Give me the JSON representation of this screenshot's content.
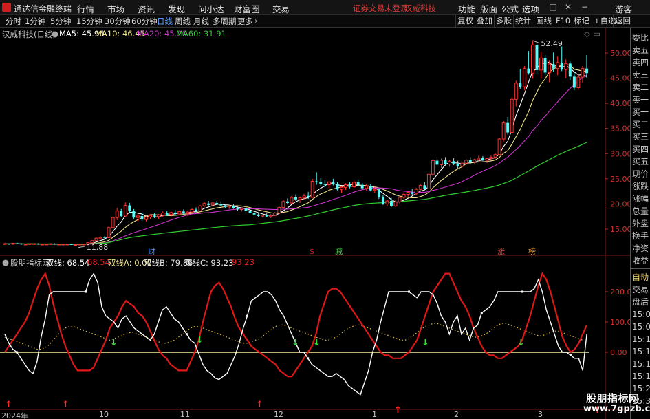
{
  "titlebar": {
    "app_name": "通达信金融终端",
    "menus": [
      "行情",
      "市场",
      "资讯",
      "发现",
      "问小达",
      "财富圈",
      "交易"
    ],
    "notice": "证券交易未登录",
    "stock_name": "汉威科技",
    "right_menus": [
      "功能",
      "版面",
      "公式",
      "选项"
    ],
    "guest": "游客"
  },
  "toolbar": {
    "periods": [
      "分时",
      "1分钟",
      "5分钟",
      "15分钟",
      "30分钟",
      "60分钟",
      "日线",
      "周线",
      "月线",
      "多周期",
      "更多"
    ],
    "active_period": "日线",
    "right_buttons": [
      "复权",
      "叠加",
      "多股",
      "统计",
      "画线",
      "F10",
      "标记",
      "+自选",
      "返回"
    ]
  },
  "main_info": {
    "title": "汉威科技(日线)",
    "ma5": "MA5: 45.96",
    "ma10": "MA10: 46.45",
    "ma20": "MA20: 45.20",
    "ma60": "MA60: 31.91",
    "colors": {
      "ma5": "#ffffff",
      "ma10": "#f0e68c",
      "ma20": "#cc33cc",
      "ma60": "#33cc33"
    }
  },
  "price_axis": [
    "50.00",
    "45.00",
    "40.00",
    "35.00",
    "30.00",
    "25.00",
    "20.00",
    "15.00"
  ],
  "annotations": {
    "high": "52.49",
    "low": "11.88",
    "badges": [
      "财",
      "$",
      "减",
      "涨",
      "榜"
    ]
  },
  "indicator_info": {
    "name": "股朋指标网",
    "line": "双线: 68.54",
    "line_value2": "68.54",
    "a": "双线A: 0.00",
    "b": "双线B: 79.86",
    "c": "双线C: 93.23",
    "c_value2": "93.23"
  },
  "indicator_axis": [
    "200.00",
    "100.00",
    "0.00"
  ],
  "date_axis": [
    "2024年",
    "10",
    "11",
    "12",
    "1",
    "2",
    "3"
  ],
  "right_panel": {
    "top_items": [
      "委比",
      "卖五",
      "卖四",
      "卖三",
      "卖二",
      "卖一",
      "买一",
      "买二",
      "买三",
      "买四",
      "买五",
      "现价",
      "涨跌",
      "涨幅",
      "总量",
      "外盘",
      "换手",
      "净资",
      "收益"
    ],
    "bottom_items": [
      "自动",
      "交易",
      "盘后",
      "15:00",
      "15:08",
      "15:10",
      "15:11",
      "15:15",
      "15:16",
      "15:25",
      "15:30"
    ]
  },
  "watermark": {
    "line1": "股朋指标网",
    "line2": "www.7gpzb.com"
  },
  "chart_data": {
    "type": "candlestick",
    "y_range": [
      10,
      55
    ],
    "ohlc": [
      [
        12.0,
        12.3,
        11.9,
        12.1
      ],
      [
        12.1,
        12.2,
        11.9,
        12.0
      ],
      [
        12.0,
        12.3,
        11.9,
        12.2
      ],
      [
        12.2,
        12.3,
        12.0,
        12.1
      ],
      [
        12.1,
        12.2,
        11.9,
        12.0
      ],
      [
        12.0,
        12.1,
        11.9,
        12.0
      ],
      [
        12.0,
        12.2,
        11.9,
        12.1
      ],
      [
        12.1,
        12.2,
        12.0,
        12.1
      ],
      [
        12.1,
        12.2,
        11.9,
        12.0
      ],
      [
        12.0,
        12.1,
        11.9,
        12.0
      ],
      [
        12.0,
        12.1,
        11.9,
        12.0
      ],
      [
        12.0,
        12.2,
        11.9,
        12.1
      ],
      [
        12.1,
        12.2,
        11.9,
        12.0
      ],
      [
        12.0,
        12.1,
        11.9,
        12.0
      ],
      [
        12.0,
        12.1,
        11.9,
        12.0
      ],
      [
        12.0,
        12.1,
        11.9,
        12.0
      ],
      [
        12.0,
        12.0,
        11.9,
        11.9
      ],
      [
        11.9,
        12.0,
        11.88,
        11.9
      ],
      [
        11.9,
        12.1,
        11.9,
        12.0
      ],
      [
        12.0,
        12.1,
        11.9,
        12.0
      ],
      [
        12.0,
        12.4,
        11.9,
        12.3
      ],
      [
        12.3,
        12.8,
        12.2,
        12.7
      ],
      [
        12.7,
        13.3,
        12.6,
        13.2
      ],
      [
        13.2,
        13.6,
        13.0,
        13.4
      ],
      [
        13.4,
        13.6,
        13.1,
        13.3
      ],
      [
        13.3,
        15.5,
        13.2,
        15.3
      ],
      [
        15.3,
        17.5,
        15.2,
        17.3
      ],
      [
        17.3,
        19.2,
        16.8,
        18.6
      ],
      [
        18.6,
        19.0,
        17.4,
        17.6
      ],
      [
        17.6,
        20.3,
        17.5,
        19.7
      ],
      [
        19.7,
        20.2,
        18.2,
        18.6
      ],
      [
        18.6,
        19.0,
        17.0,
        17.3
      ],
      [
        17.3,
        18.0,
        16.5,
        17.6
      ],
      [
        17.6,
        18.3,
        16.6,
        16.9
      ],
      [
        16.9,
        17.6,
        16.5,
        17.4
      ],
      [
        17.4,
        18.0,
        17.0,
        17.7
      ],
      [
        17.7,
        18.2,
        17.2,
        17.5
      ],
      [
        17.5,
        18.0,
        17.0,
        17.8
      ],
      [
        17.8,
        18.5,
        17.4,
        18.2
      ],
      [
        18.2,
        18.6,
        17.6,
        17.9
      ],
      [
        17.9,
        18.5,
        17.5,
        18.3
      ],
      [
        18.3,
        18.8,
        17.9,
        18.0
      ],
      [
        18.0,
        18.7,
        17.8,
        18.5
      ],
      [
        18.5,
        18.9,
        17.9,
        18.1
      ],
      [
        18.1,
        18.6,
        17.6,
        18.4
      ],
      [
        18.4,
        19.1,
        18.2,
        18.9
      ],
      [
        18.9,
        19.3,
        18.4,
        18.6
      ],
      [
        18.6,
        19.8,
        18.5,
        19.6
      ],
      [
        19.6,
        20.4,
        19.3,
        20.1
      ],
      [
        20.1,
        20.6,
        19.6,
        19.8
      ],
      [
        19.8,
        20.4,
        19.5,
        20.2
      ],
      [
        20.2,
        20.6,
        19.8,
        20.0
      ],
      [
        20.0,
        20.5,
        19.5,
        19.7
      ],
      [
        19.7,
        20.0,
        19.1,
        19.4
      ],
      [
        19.4,
        19.9,
        19.0,
        19.6
      ],
      [
        19.6,
        20.0,
        19.0,
        19.2
      ],
      [
        19.2,
        19.6,
        18.6,
        18.9
      ],
      [
        18.9,
        19.4,
        18.5,
        19.1
      ],
      [
        19.1,
        19.4,
        18.4,
        18.6
      ],
      [
        18.6,
        18.9,
        18.0,
        18.2
      ],
      [
        18.2,
        18.5,
        17.7,
        17.9
      ],
      [
        17.9,
        18.3,
        17.4,
        17.6
      ],
      [
        17.6,
        18.0,
        17.3,
        17.8
      ],
      [
        17.8,
        18.2,
        17.4,
        17.5
      ],
      [
        17.5,
        18.0,
        17.2,
        17.7
      ],
      [
        17.7,
        18.4,
        17.6,
        18.2
      ],
      [
        18.2,
        19.5,
        18.0,
        19.3
      ],
      [
        19.3,
        20.8,
        19.0,
        20.5
      ],
      [
        20.5,
        21.1,
        19.9,
        20.2
      ],
      [
        20.2,
        21.6,
        20.0,
        21.3
      ],
      [
        21.3,
        21.9,
        20.6,
        20.9
      ],
      [
        20.9,
        21.5,
        20.2,
        21.2
      ],
      [
        21.2,
        22.0,
        20.8,
        21.6
      ],
      [
        21.6,
        22.4,
        21.0,
        21.3
      ],
      [
        21.3,
        25.0,
        21.2,
        24.5
      ],
      [
        24.5,
        26.3,
        23.8,
        24.3
      ],
      [
        24.3,
        25.2,
        23.5,
        24.0
      ],
      [
        24.0,
        24.7,
        23.3,
        23.8
      ],
      [
        23.8,
        24.5,
        23.2,
        24.4
      ],
      [
        24.4,
        25.0,
        23.7,
        23.9
      ],
      [
        23.9,
        24.3,
        22.7,
        22.9
      ],
      [
        22.9,
        23.6,
        22.2,
        23.3
      ],
      [
        23.3,
        24.1,
        22.8,
        23.8
      ],
      [
        23.8,
        24.3,
        23.1,
        23.4
      ],
      [
        23.4,
        24.6,
        23.2,
        24.3
      ],
      [
        24.3,
        24.9,
        23.6,
        23.8
      ],
      [
        23.8,
        24.2,
        22.9,
        23.1
      ],
      [
        23.1,
        23.9,
        22.6,
        23.6
      ],
      [
        23.6,
        24.0,
        22.5,
        22.7
      ],
      [
        22.7,
        23.4,
        22.2,
        22.9
      ],
      [
        22.9,
        23.1,
        21.0,
        21.3
      ],
      [
        21.3,
        21.8,
        19.8,
        20.0
      ],
      [
        20.0,
        20.8,
        19.5,
        20.6
      ],
      [
        20.6,
        21.2,
        19.4,
        19.6
      ],
      [
        19.6,
        20.7,
        19.4,
        20.4
      ],
      [
        20.4,
        21.6,
        20.1,
        21.3
      ],
      [
        21.3,
        22.3,
        21.0,
        21.9
      ],
      [
        21.9,
        22.6,
        21.2,
        22.3
      ],
      [
        22.3,
        23.0,
        21.7,
        22.0
      ],
      [
        22.0,
        23.2,
        21.8,
        22.9
      ],
      [
        22.9,
        24.0,
        22.7,
        23.7
      ],
      [
        23.7,
        24.3,
        22.8,
        23.0
      ],
      [
        23.0,
        26.2,
        22.9,
        25.9
      ],
      [
        25.9,
        28.9,
        25.5,
        28.6
      ],
      [
        28.6,
        29.4,
        27.6,
        27.8
      ],
      [
        27.8,
        29.0,
        27.2,
        28.7
      ],
      [
        28.7,
        29.3,
        27.6,
        27.9
      ],
      [
        27.9,
        28.8,
        27.4,
        28.5
      ],
      [
        28.5,
        29.1,
        27.7,
        28.0
      ],
      [
        28.0,
        28.6,
        27.0,
        27.5
      ],
      [
        27.5,
        28.4,
        27.2,
        28.1
      ],
      [
        28.1,
        29.0,
        27.8,
        28.7
      ],
      [
        28.7,
        29.3,
        28.0,
        28.3
      ],
      [
        28.3,
        29.0,
        27.9,
        28.8
      ],
      [
        28.8,
        29.6,
        28.4,
        29.1
      ],
      [
        29.1,
        29.5,
        28.5,
        28.7
      ],
      [
        28.7,
        29.2,
        28.1,
        29.0
      ],
      [
        29.0,
        29.6,
        28.6,
        29.3
      ],
      [
        29.3,
        30.1,
        29.0,
        29.8
      ],
      [
        29.8,
        33.2,
        29.6,
        32.9
      ],
      [
        32.9,
        36.5,
        32.4,
        36.1
      ],
      [
        36.1,
        37.3,
        33.8,
        34.2
      ],
      [
        34.2,
        41.2,
        34.0,
        40.8
      ],
      [
        40.8,
        44.5,
        39.4,
        44.0
      ],
      [
        44.0,
        46.8,
        42.9,
        43.3
      ],
      [
        43.3,
        47.4,
        42.6,
        46.9
      ],
      [
        46.9,
        50.4,
        45.7,
        46.0
      ],
      [
        46.0,
        52.49,
        44.9,
        51.6
      ],
      [
        51.6,
        51.8,
        45.9,
        46.6
      ],
      [
        46.6,
        50.2,
        44.9,
        49.0
      ],
      [
        49.0,
        49.6,
        45.6,
        46.1
      ],
      [
        46.1,
        48.6,
        44.2,
        47.8
      ],
      [
        47.8,
        50.1,
        46.3,
        46.9
      ],
      [
        46.9,
        49.3,
        45.6,
        48.1
      ],
      [
        48.1,
        51.3,
        46.4,
        46.7
      ],
      [
        46.7,
        48.7,
        45.0,
        47.9
      ],
      [
        47.9,
        48.3,
        44.6,
        45.3
      ],
      [
        45.3,
        46.0,
        42.6,
        43.1
      ],
      [
        43.1,
        45.7,
        42.7,
        45.2
      ],
      [
        45.2,
        47.4,
        44.1,
        46.9
      ],
      [
        46.9,
        49.6,
        45.1,
        46.0
      ]
    ],
    "indicator": {
      "white": [
        60,
        30,
        10,
        0,
        -20,
        -40,
        -60,
        -70,
        -30,
        50,
        110,
        190,
        200,
        200,
        200,
        200,
        200,
        200,
        200,
        200,
        200,
        240,
        260,
        230,
        150,
        120,
        110,
        100,
        80,
        110,
        120,
        100,
        80,
        70,
        60,
        50,
        40,
        60,
        100,
        140,
        150,
        130,
        110,
        100,
        80,
        60,
        40,
        30,
        -5,
        -40,
        -60,
        -70,
        -85,
        -90,
        -80,
        -70,
        -40,
        -10,
        30,
        80,
        120,
        170,
        180,
        190,
        200,
        200,
        190,
        170,
        140,
        120,
        90,
        60,
        30,
        0,
        0,
        -20,
        -40,
        -50,
        -60,
        -70,
        -80,
        -80,
        -70,
        -80,
        -90,
        -110,
        -120,
        -130,
        -140,
        -100,
        -60,
        0,
        40,
        100,
        150,
        200,
        200,
        200,
        200,
        200,
        200,
        190,
        180,
        200,
        200,
        200,
        190,
        160,
        120,
        100,
        60,
        100,
        120,
        60,
        80,
        40,
        80,
        90,
        130,
        140,
        150,
        170,
        200,
        200,
        200,
        200,
        200,
        200,
        200,
        200,
        200,
        210,
        240,
        200,
        140,
        100,
        60,
        20,
        0,
        0,
        -10,
        -20,
        -20,
        -60,
        60
      ],
      "red": [
        0,
        20,
        40,
        60,
        80,
        100,
        130,
        170,
        210,
        240,
        260,
        220,
        160,
        110,
        60,
        20,
        -10,
        -40,
        -60,
        -60,
        -60,
        -60,
        -50,
        -20,
        10,
        40,
        80,
        100,
        120,
        150,
        170,
        160,
        150,
        130,
        120,
        100,
        70,
        40,
        10,
        -10,
        -20,
        -40,
        -50,
        -60,
        -60,
        -60,
        -30,
        0,
        40,
        100,
        150,
        200,
        220,
        230,
        210,
        180,
        150,
        110,
        80,
        60,
        40,
        20,
        10,
        0,
        -10,
        -20,
        -30,
        -40,
        -60,
        -70,
        -80,
        -80,
        -60,
        -40,
        -20,
        0,
        20,
        60,
        120,
        160,
        200,
        210,
        210,
        200,
        180,
        160,
        140,
        120,
        100,
        80,
        60,
        40,
        20,
        0,
        -10,
        -10,
        -20,
        -20,
        -20,
        -10,
        0,
        20,
        40,
        80,
        120,
        160,
        200,
        220,
        240,
        260,
        260,
        230,
        200,
        170,
        150,
        120,
        80,
        50,
        20,
        0,
        -10,
        -10,
        -20,
        -20,
        -10,
        0,
        10,
        20,
        40,
        80,
        120,
        170,
        220,
        260,
        240,
        200,
        150,
        100,
        50,
        20,
        0,
        10,
        30,
        60,
        90
      ],
      "dotted": [
        50,
        45,
        40,
        35,
        30,
        25,
        20,
        15,
        10,
        10,
        15,
        25,
        40,
        55,
        70,
        80,
        85,
        85,
        80,
        75,
        70,
        65,
        60,
        55,
        50,
        45,
        40,
        45,
        50,
        55,
        60,
        65,
        65,
        60,
        55,
        50,
        45,
        40,
        35,
        30,
        30,
        35,
        40,
        50,
        60,
        70,
        80,
        85,
        85,
        80,
        75,
        70,
        65,
        60,
        55,
        50,
        45,
        40,
        35,
        30,
        30,
        35,
        40,
        45,
        55,
        65,
        75,
        85,
        90,
        90,
        85,
        80,
        75,
        70,
        65,
        60,
        55,
        50,
        45,
        40,
        40,
        45,
        50,
        60,
        70,
        80,
        85,
        90,
        90,
        85,
        80,
        75,
        70,
        65,
        60,
        55,
        50,
        45,
        40,
        40,
        45,
        55,
        65,
        75,
        85,
        90,
        95,
        95,
        90,
        85,
        80,
        75,
        70,
        65,
        60,
        55,
        50,
        50,
        55,
        60,
        70,
        80,
        90,
        95,
        95,
        90,
        85,
        80,
        75,
        70,
        65,
        60,
        55,
        55,
        60,
        65,
        70,
        70,
        65,
        60,
        55,
        50,
        45,
        40
      ],
      "zero_level": 0
    },
    "ma60_end": 31.91
  }
}
